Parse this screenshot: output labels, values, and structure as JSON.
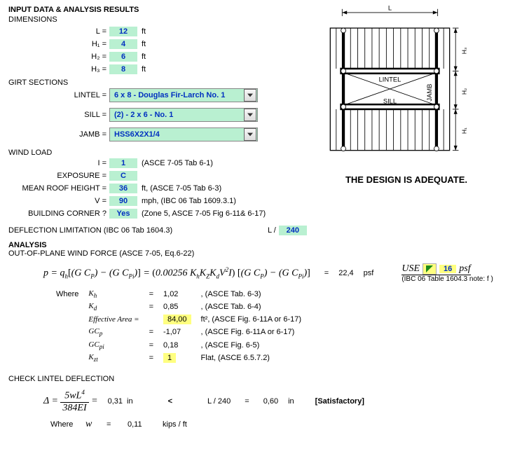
{
  "header": {
    "title": "INPUT DATA & ANALYSIS RESULTS",
    "dims_label": "DIMENSIONS"
  },
  "dimensions": {
    "L_label": "L =",
    "L_val": "12",
    "L_unit": "ft",
    "H1_label": "H₁ =",
    "H1_val": "4",
    "H1_unit": "ft",
    "H2_label": "H₂ =",
    "H2_val": "6",
    "H2_unit": "ft",
    "H3_label": "H₃ =",
    "H3_val": "8",
    "H3_unit": "ft"
  },
  "girt": {
    "heading": "GIRT SECTIONS",
    "lintel_label": "LINTEL =",
    "lintel_val": "6 x 8 - Douglas Fir-Larch No. 1",
    "sill_label": "SILL =",
    "sill_val": "(2) - 2 x 6 - No. 1",
    "jamb_label": "JAMB =",
    "jamb_val": "HSS6X2X1/4"
  },
  "wind": {
    "heading": "WIND LOAD",
    "I_label": "I =",
    "I_val": "1",
    "I_note": "(ASCE 7-05 Tab 6-1)",
    "exp_label": "EXPOSURE =",
    "exp_val": "C",
    "mrh_label": "MEAN ROOF HEIGHT =",
    "mrh_val": "36",
    "mrh_note": "ft,   (ASCE 7-05 Tab 6-3)",
    "V_label": "V =",
    "V_val": "90",
    "V_note": "mph,   (IBC 06 Tab 1609.3.1)",
    "bc_label": "BUILDING CORNER ?",
    "bc_val": "Yes",
    "bc_note": "(Zone 5, ASCE 7-05 Fig 6-11&  6-17)"
  },
  "deflection_limit": {
    "label": "DEFLECTION LIMITATION (IBC 06 Tab 1604.3)",
    "val_prefix": "L /",
    "val": "240"
  },
  "analysis": {
    "heading": "ANALYSIS",
    "subheading": "OUT-OF-PLANE WIND FORCE (ASCE 7-05, Eq.6-22)",
    "p_result_val": "22,4",
    "p_result_unit": "psf",
    "use_label": "USE",
    "use_val": "16",
    "use_unit": "psf",
    "use_note": "(IBC 06 Table 1604.3 note: f )",
    "where_label": "Where",
    "params": {
      "Kh_sym": "K",
      "Kh_sub": "h",
      "Kh_val": "1,02",
      "Kh_note": ", (ASCE Tab. 6-3)",
      "Kd_sym": "K",
      "Kd_sub": "d",
      "Kd_val": "0,85",
      "Kd_note": ", (ASCE Tab. 6-4)",
      "EA_label": "Effective Area =",
      "EA_val": "84,00",
      "EA_note": "ft², (ASCE Fig. 6-11A or 6-17)",
      "GCp_sym": "GC",
      "GCp_sub": "p",
      "GCp_val": "-1,07",
      "GCp_note": ", (ASCE Fig. 6-11A or 6-17)",
      "GCpi_sym": "GC",
      "GCpi_sub": "pi",
      "GCpi_val": "0,18",
      "GCpi_note": ", (ASCE Fig. 6-5)",
      "Kzt_sym": "K",
      "Kzt_sub": "zt",
      "Kzt_val": "1",
      "Kzt_note": "Flat, (ASCE 6.5.7.2)"
    }
  },
  "lintel_check": {
    "heading": "CHECK LINTEL DEFLECTION",
    "delta_val": "0,31",
    "delta_unit": "in",
    "cmp": "<",
    "limit_label": "L / 240",
    "eq_sign": "=",
    "limit_val": "0,60",
    "limit_unit": "in",
    "result": "[Satisfactory]",
    "where_label": "Where",
    "w_sym": "w",
    "w_eq": "=",
    "w_val": "0,11",
    "w_unit": "kips / ft"
  },
  "diagram": {
    "L": "L",
    "H1": "H₁",
    "H2": "H₂",
    "H3": "H₃",
    "lintel": "LINTEL",
    "sill": "SILL",
    "jamb": "JAMB",
    "adequate": "THE DESIGN IS ADEQUATE."
  }
}
